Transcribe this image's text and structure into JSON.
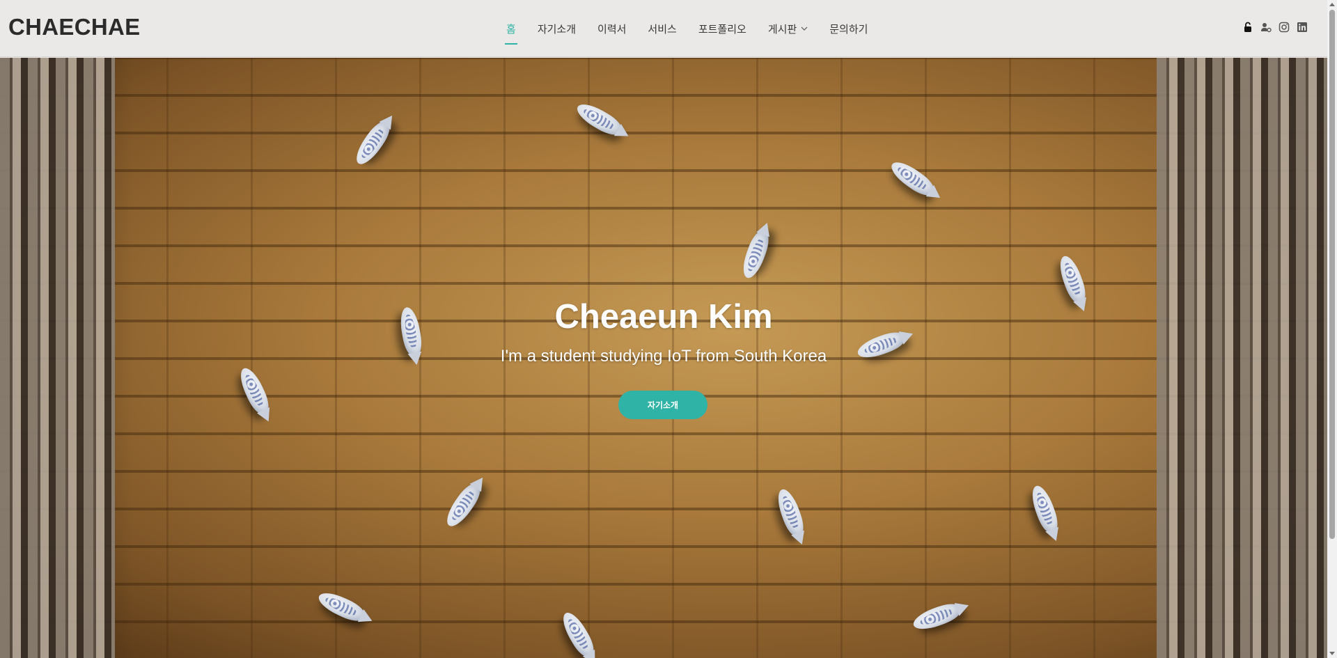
{
  "header": {
    "logo": "CHAECHAE",
    "nav": [
      {
        "label": "홈",
        "active": true
      },
      {
        "label": "자기소개"
      },
      {
        "label": "이력서"
      },
      {
        "label": "서비스"
      },
      {
        "label": "포트폴리오"
      },
      {
        "label": "게시판",
        "dropdown": true
      },
      {
        "label": "문의하기"
      }
    ],
    "icons": [
      "lock-icon",
      "user-settings-icon",
      "instagram-icon",
      "linkedin-icon"
    ]
  },
  "hero": {
    "title": "Cheaeun Kim",
    "subtitle": "I'm a student studying IoT from South Korea",
    "button_label": "자기소개"
  },
  "colors": {
    "accent": "#2fb3a6",
    "header_bg": "#ebe9e7",
    "text": "#2b2b2b"
  }
}
